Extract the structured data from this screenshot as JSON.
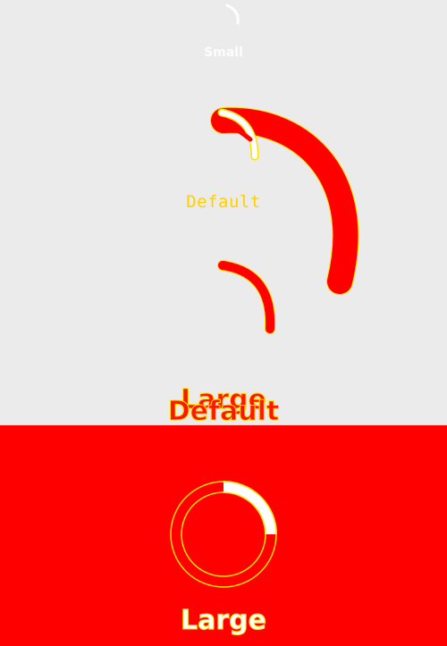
{
  "spinners": {
    "small": {
      "label": "Small"
    },
    "default": {
      "label": "Default"
    },
    "large": {
      "label": "Large"
    }
  },
  "overlay": {
    "large_label_ghost": "Large",
    "default_label_ghost": "Default"
  },
  "colors": {
    "background": "#ebebeb",
    "accent": "#ff0000",
    "highlight": "#ffe000",
    "indicator": "#ffffff"
  }
}
